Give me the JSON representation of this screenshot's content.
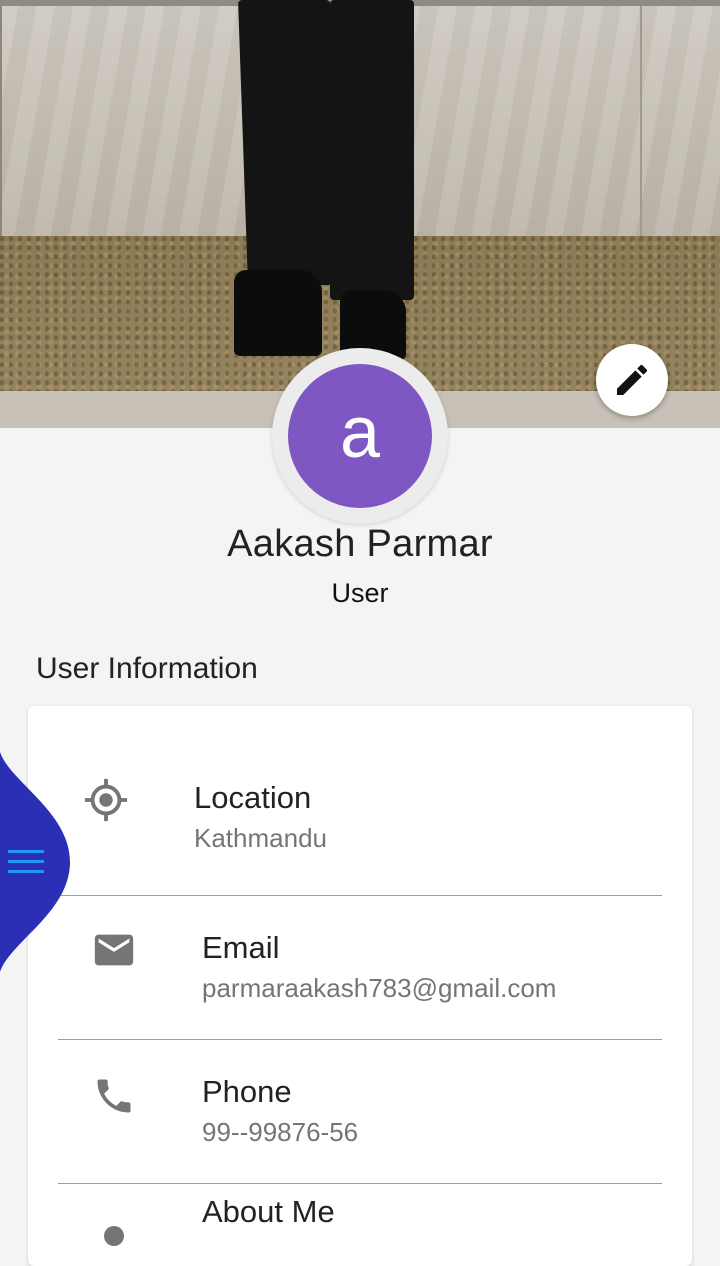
{
  "profile": {
    "avatar_initial": "a",
    "name": "Aakash Parmar",
    "role": "User"
  },
  "section": {
    "title": "User Information"
  },
  "info": {
    "location": {
      "label": "Location",
      "value": "Kathmandu",
      "icon": "target-location-icon"
    },
    "email": {
      "label": "Email",
      "value": "parmaraakash783@gmail.com",
      "icon": "mail-icon"
    },
    "phone": {
      "label": "Phone",
      "value": "99--99876-56",
      "icon": "phone-icon"
    },
    "about": {
      "label": "About Me",
      "icon": "person-icon"
    }
  },
  "colors": {
    "avatar_bg": "#7e57c2",
    "drawer_tab": "#2a2fb5",
    "menu_icon": "#2196f3"
  }
}
